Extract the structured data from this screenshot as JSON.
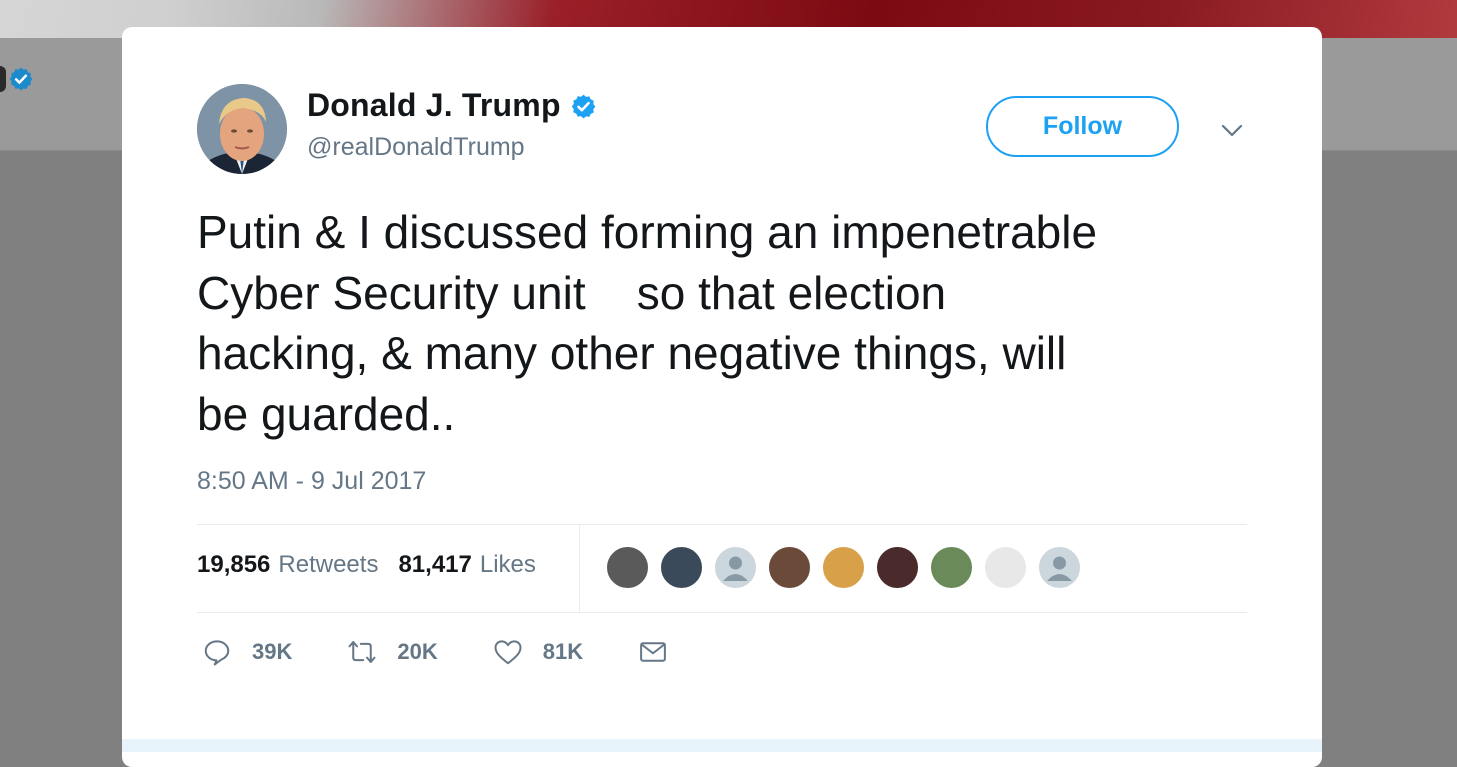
{
  "tweet": {
    "display_name": "Donald J. Trump",
    "handle": "@realDonaldTrump",
    "follow_label": "Follow",
    "text": "Putin & I discussed forming an impenetrable\nCyber Security unit    so that election\nhacking, & many other negative things, will\nbe guarded..",
    "timestamp": "8:50 AM - 9 Jul 2017"
  },
  "stats": {
    "retweets_count": "19,856",
    "retweets_label": "Retweets",
    "likes_count": "81,417",
    "likes_label": "Likes"
  },
  "liked_by": [
    {
      "name": "liker-avatar-1",
      "color": "#5a5a5a"
    },
    {
      "name": "liker-avatar-2",
      "color": "#3a4a5a"
    },
    {
      "name": "liker-avatar-3",
      "color": "#ccd6dd"
    },
    {
      "name": "liker-avatar-4",
      "color": "#6b4a3a"
    },
    {
      "name": "liker-avatar-5",
      "color": "#d9a04a"
    },
    {
      "name": "liker-avatar-6",
      "color": "#4a2a2a"
    },
    {
      "name": "liker-avatar-7",
      "color": "#6a8a5a"
    },
    {
      "name": "liker-avatar-8",
      "color": "#e8e8e8"
    },
    {
      "name": "liker-avatar-9",
      "color": "#ccd6dd"
    }
  ],
  "actions": {
    "reply_count": "39K",
    "retweet_count": "20K",
    "like_count": "81K"
  },
  "icons": {
    "verified": "verified-badge-icon",
    "caret": "chevron-down-icon",
    "reply": "reply-icon",
    "retweet": "retweet-icon",
    "like": "heart-icon",
    "dm": "envelope-icon"
  },
  "colors": {
    "accent": "#1da1f2",
    "text": "#14171a",
    "muted": "#657786"
  }
}
